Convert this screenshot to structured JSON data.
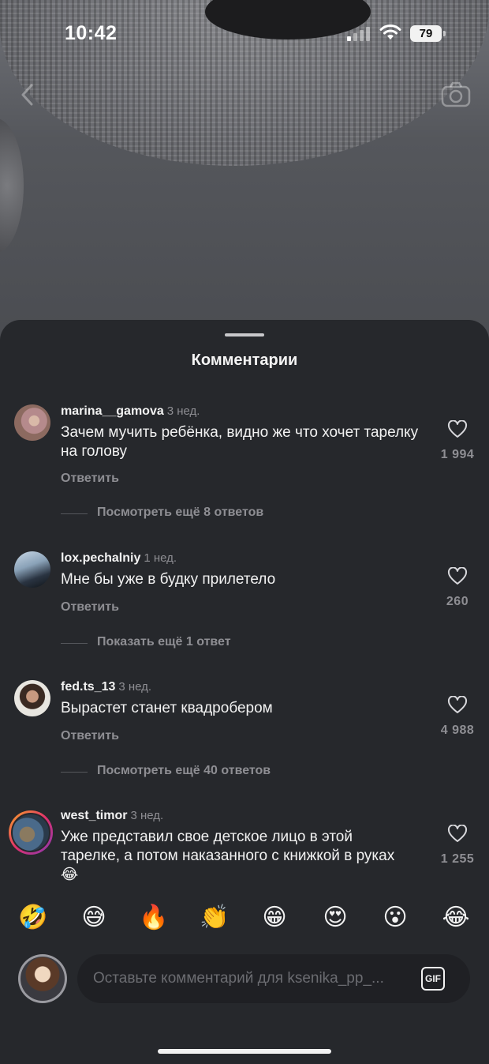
{
  "status_bar": {
    "time": "10:42",
    "battery": "79"
  },
  "sheet": {
    "title": "Комментарии"
  },
  "comments": [
    {
      "username": "marina__gamova",
      "ago": "3 нед.",
      "text": "Зачем мучить ребёнка, видно же что хочет тарелку на голову",
      "reply_label": "Ответить",
      "likes": "1 994",
      "more_replies": "Посмотреть ещё 8 ответов"
    },
    {
      "username": "lox.pechalniy",
      "ago": "1 нед.",
      "text": "Мне бы уже в будку прилетело",
      "reply_label": "Ответить",
      "likes": "260",
      "more_replies": "Показать ещё 1 ответ"
    },
    {
      "username": "fed.ts_13",
      "ago": "3 нед.",
      "text": "Вырастет станет квадробером",
      "reply_label": "Ответить",
      "likes": "4 988",
      "more_replies": "Посмотреть ещё 40 ответов"
    },
    {
      "username": "west_timor",
      "ago": "3 нед.",
      "text": "Уже представил свое детское лицо в этой тарелке, а потом наказанного с книжкой в руках 😂",
      "likes": "1 255"
    }
  ],
  "emojis": [
    "🤣",
    "😅",
    "🔥",
    "👏",
    "😁",
    "😍",
    "😮",
    "😂"
  ],
  "composer": {
    "placeholder": "Оставьте комментарий для ksenika_pp_...",
    "gif_label": "GIF"
  },
  "colors": {
    "sheet_bg": "#26282c",
    "muted": "#8e8e93"
  },
  "icons": [
    "back-arrow-icon",
    "camera-icon",
    "heart-icon",
    "signal-icon",
    "wifi-icon",
    "battery-icon",
    "gif-icon"
  ]
}
